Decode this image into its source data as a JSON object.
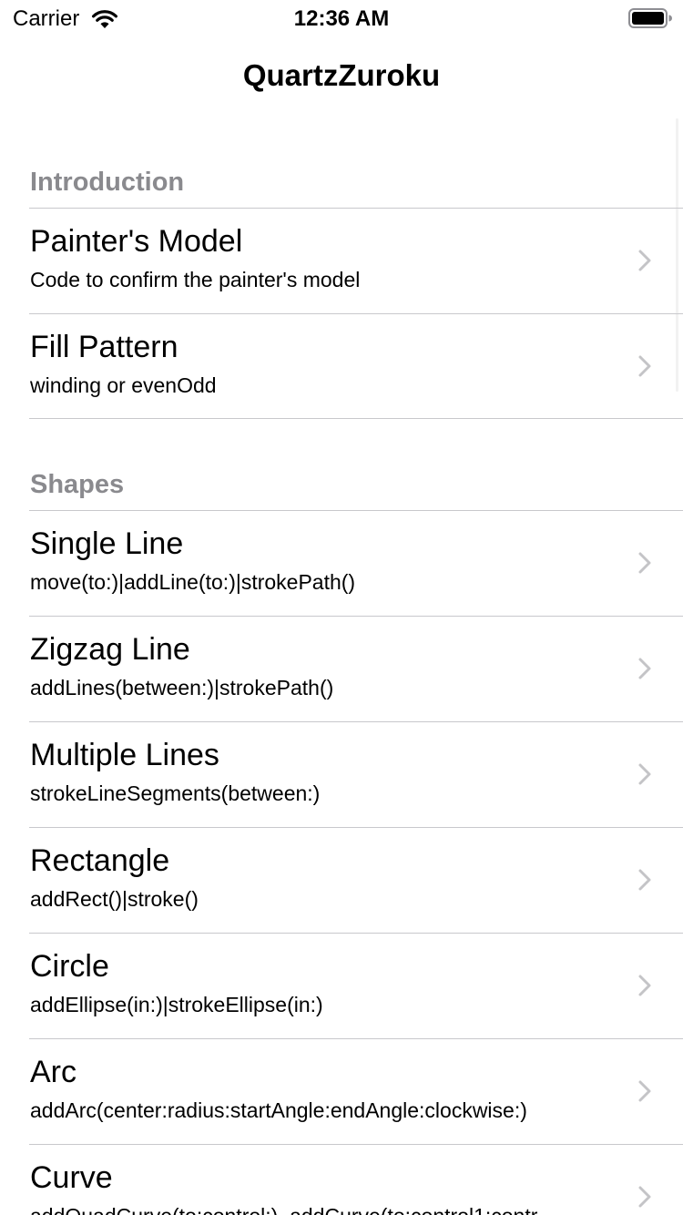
{
  "status_bar": {
    "carrier": "Carrier",
    "time": "12:36 AM",
    "icons": [
      "wifi-icon",
      "battery-icon"
    ]
  },
  "nav": {
    "title": "QuartzZuroku"
  },
  "sections": [
    {
      "header": "Introduction",
      "rows": [
        {
          "title": "Painter's Model",
          "subtitle": "Code to confirm the painter's model"
        },
        {
          "title": "Fill Pattern",
          "subtitle": "winding or evenOdd"
        }
      ]
    },
    {
      "header": "Shapes",
      "rows": [
        {
          "title": "Single Line",
          "subtitle": "move(to:)|addLine(to:)|strokePath()"
        },
        {
          "title": "Zigzag Line",
          "subtitle": "addLines(between:)|strokePath()"
        },
        {
          "title": "Multiple Lines",
          "subtitle": "strokeLineSegments(between:)"
        },
        {
          "title": "Rectangle",
          "subtitle": "addRect()|stroke()"
        },
        {
          "title": "Circle",
          "subtitle": "addEllipse(in:)|strokeEllipse(in:)"
        },
        {
          "title": "Arc",
          "subtitle": "addArc(center:radius:startAngle:endAngle:clockwise:)"
        },
        {
          "title": "Curve",
          "subtitle": "addQuadCurve(to:control:), addCurve(to:control1:contr"
        }
      ]
    }
  ],
  "colors": {
    "section_header": "#8a8a8e",
    "separator": "#c8c8cc",
    "chevron": "#c4c4c7"
  }
}
